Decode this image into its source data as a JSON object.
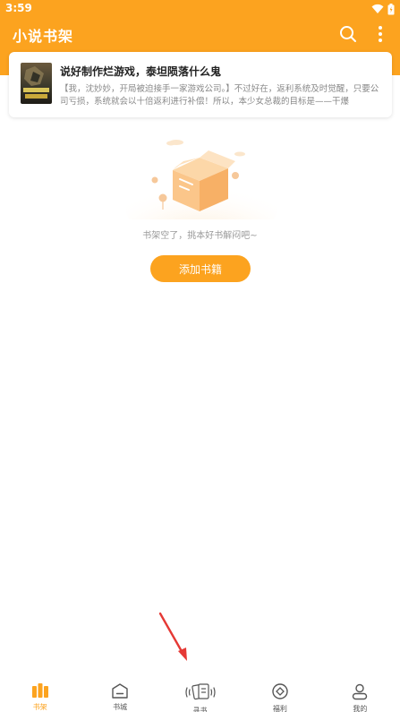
{
  "status_bar": {
    "time": "3:59"
  },
  "app_bar": {
    "title": "小说书架"
  },
  "book": {
    "title": "说好制作烂游戏，泰坦陨落什么鬼",
    "description": "【我，沈妙妙，开局被迫接手一家游戏公司。】不过好在，返利系统及时觉醒，只要公司亏损，系统就会以十倍返利进行补偿！所以，本少女总裁的目标是——干爆"
  },
  "empty_state": {
    "message": "书架空了，挑本好书解闷吧~",
    "add_button": "添加书籍"
  },
  "nav": {
    "items": [
      {
        "label": "书架",
        "icon": "bookshelf-icon",
        "active": true
      },
      {
        "label": "书城",
        "icon": "bookstore-icon",
        "active": false
      },
      {
        "label": "寻书",
        "icon": "find-book-icon",
        "active": false
      },
      {
        "label": "福利",
        "icon": "welfare-icon",
        "active": false
      },
      {
        "label": "我的",
        "icon": "profile-icon",
        "active": false
      }
    ]
  },
  "colors": {
    "primary": "#fca31f",
    "annotation": "#e53935"
  }
}
